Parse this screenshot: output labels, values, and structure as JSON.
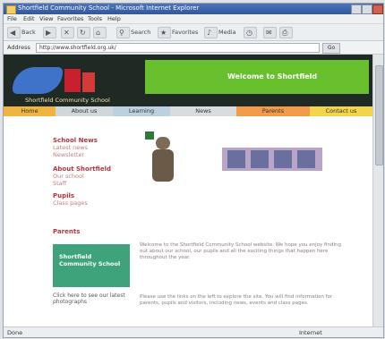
{
  "window": {
    "title": "Shortfield Community School - Microsoft Internet Explorer"
  },
  "menu": [
    "File",
    "Edit",
    "View",
    "Favorites",
    "Tools",
    "Help"
  ],
  "toolbar": {
    "back": "Back",
    "search": "Search",
    "favorites": "Favorites",
    "media": "Media"
  },
  "address": {
    "label": "Address",
    "url": "http://www.shortfield.org.uk/",
    "go": "Go"
  },
  "status": {
    "text": "Done",
    "zone": "Internet"
  },
  "page": {
    "banner_text": "Welcome to Shortfield",
    "tagline": "Shortfield Community School",
    "nav": [
      "Home",
      "About us",
      "Learning",
      "News",
      "Parents",
      "Contact us"
    ],
    "sidebar": [
      {
        "heading": "School News",
        "links": [
          "Latest news",
          "Newsletter"
        ]
      },
      {
        "heading": "About Shortfield",
        "links": [
          "Our school",
          "Staff"
        ]
      },
      {
        "heading": "Pupils",
        "links": [
          "Class pages"
        ]
      },
      {
        "heading": "Parents",
        "links": []
      }
    ],
    "feature_box": "Shortfield Community School",
    "caption": "Click here to see our latest photographs",
    "paragraphs": [
      "Welcome to the Shortfield Community School website. We hope you enjoy finding out about our school, our pupils and all the exciting things that happen here throughout the year.",
      "Please use the links on the left to explore the site. You will find information for parents, pupils and visitors, including news, events and class pages."
    ]
  }
}
